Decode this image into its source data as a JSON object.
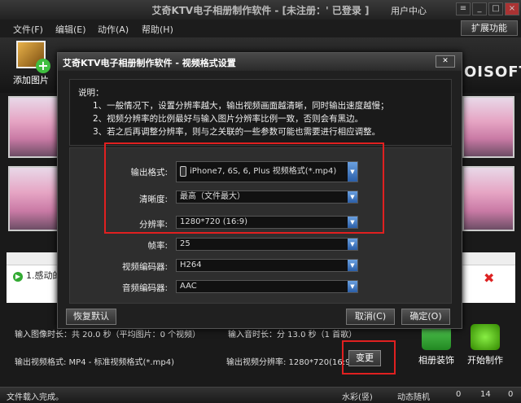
{
  "window": {
    "title": "艾奇KTV电子相册制作软件 - [未注册：' 已登录 ]",
    "user_center": "用户中心"
  },
  "menu": [
    "文件(F)",
    "编辑(E)",
    "动作(A)",
    "帮助(H)"
  ],
  "ext_button": "扩展功能",
  "toolbar": {
    "add_picture": "添加图片",
    "brand": "OISOFT"
  },
  "list": {
    "row1": "1.感动的"
  },
  "bottom": {
    "input_info": "输入图像时长：共 20.0 秒（平均图片：0 个视频）",
    "audio_info": "输入音时长：分 13.0 秒（1 首歌）",
    "out_format": "输出视频格式: MP4 - 标准视频格式(*.mp4)",
    "out_res": "输出视频分辨率: 1280*720(16:9)",
    "change": "变更",
    "album_decor": "相册装饰",
    "start": "开始制作"
  },
  "status": {
    "left": "文件载入完成。",
    "watermark": "水彩(竖)",
    "transition": "动态随机",
    "count1": "0",
    "count2": "14",
    "count3": "0"
  },
  "dialog": {
    "title": "艾奇KTV电子相册制作软件 - 视频格式设置",
    "notes": [
      "说明：",
      "1、一般情况下，设置分辨率越大，输出视频画面越清晰，同时输出速度越慢；",
      "2、视频分辨率的比例最好与输入图片分辨率比例一致，否则会有黑边。",
      "3、若之后再调整分辨率，则与之关联的一些参数可能也需要进行相应调整。"
    ],
    "fields": [
      {
        "label": "输出格式:",
        "value": "iPhone7, 6S, 6, Plus 视频格式(*.mp4)"
      },
      {
        "label": "清晰度:",
        "value": "最高（文件最大）"
      },
      {
        "label": "分辨率:",
        "value": "1280*720 (16:9)"
      },
      {
        "label": "帧率:",
        "value": "25"
      },
      {
        "label": "视频编码器:",
        "value": "H264"
      },
      {
        "label": "音频编码器:",
        "value": "AAC"
      }
    ],
    "reset": "恢复默认",
    "cancel": "取消(C)",
    "ok": "确定(O)"
  },
  "colors": {
    "highlight": "#e02020",
    "accent": "#2b5fa8"
  }
}
